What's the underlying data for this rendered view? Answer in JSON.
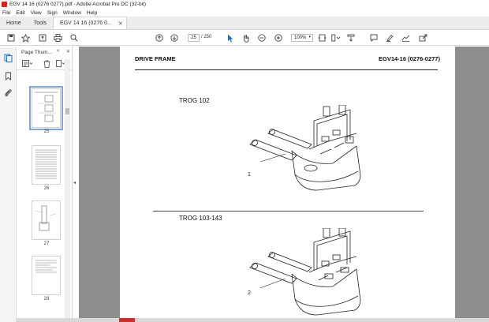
{
  "window": {
    "title": "EGV 14 16 (0276 0277).pdf - Adobe Acrobat Pro DC (32-bit)"
  },
  "menu": [
    "File",
    "Edit",
    "View",
    "Sign",
    "Window",
    "Help"
  ],
  "tabs": [
    {
      "label": "Home"
    },
    {
      "label": "Tools"
    },
    {
      "label": "EGV 14 16 (0276 0..."
    }
  ],
  "toolbar": {
    "current_page": "25",
    "page_total": "/ 250",
    "zoom": "100%"
  },
  "panel": {
    "title": "Page Thum...",
    "thumbnails": [
      {
        "page": "25",
        "selected": true
      },
      {
        "page": "26",
        "selected": false
      },
      {
        "page": "27",
        "selected": false
      },
      {
        "page": "28",
        "selected": false
      }
    ]
  },
  "document": {
    "header_left": "DRIVE FRAME",
    "header_right": "EGV14-16 (0276-0277)",
    "sections": [
      {
        "title": "TROG 102",
        "callout": "1"
      },
      {
        "title": "TROG 103-143",
        "callout": "2"
      }
    ]
  }
}
